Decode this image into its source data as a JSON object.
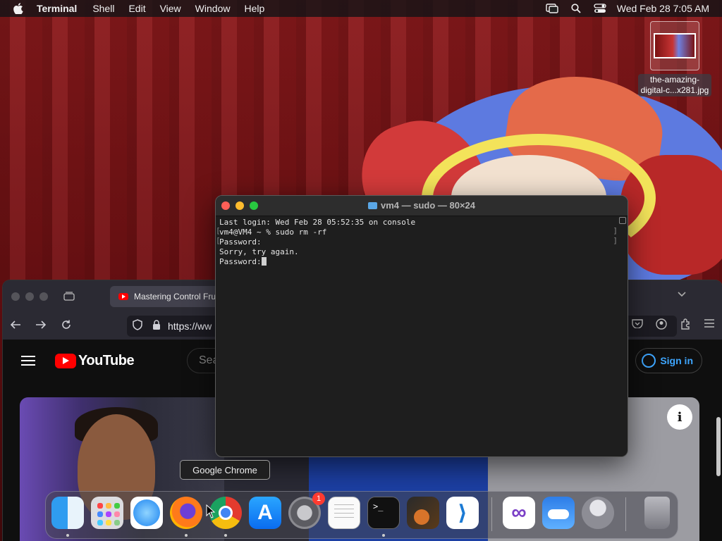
{
  "menubar": {
    "app_name": "Terminal",
    "menus": [
      "Shell",
      "Edit",
      "View",
      "Window",
      "Help"
    ],
    "datetime": "Wed Feb 28  7:05 AM",
    "status_icons": [
      "screen-mirroring-icon",
      "spotlight-search-icon",
      "control-center-icon"
    ]
  },
  "desktop_file": {
    "name_line1": "the-amazing-",
    "name_line2": "digital-c...x281.jpg"
  },
  "browser": {
    "tab_title": "Mastering Control Frui",
    "url": "https://ww",
    "youtube": {
      "logo_text": "YouTube",
      "search_placeholder": "Sea",
      "signin_label": "Sign in",
      "info_icon": "i"
    }
  },
  "terminal": {
    "title": "vm4 — sudo — 80×24",
    "lines": [
      "Last login: Wed Feb 28 05:52:35 on console",
      "vm4@VM4 ~ % sudo rm -rf",
      "Password:",
      "Sorry, try again.",
      "Password:"
    ]
  },
  "tooltip": {
    "text": "Google Chrome"
  },
  "dock": {
    "items": [
      "Finder",
      "Launchpad",
      "Safari",
      "Firefox",
      "Google Chrome",
      "App Store",
      "System Settings",
      "TextEdit",
      "Terminal",
      "GarageBand",
      "Visual Studio Code",
      "Visual Studio",
      "Weather",
      "Automator",
      "Trash"
    ],
    "settings_badge": "1",
    "terminal_icon_text": ">_",
    "appstore_glyph": "A",
    "vscode_glyph": "⟩",
    "vstudio_glyph": "∞"
  }
}
